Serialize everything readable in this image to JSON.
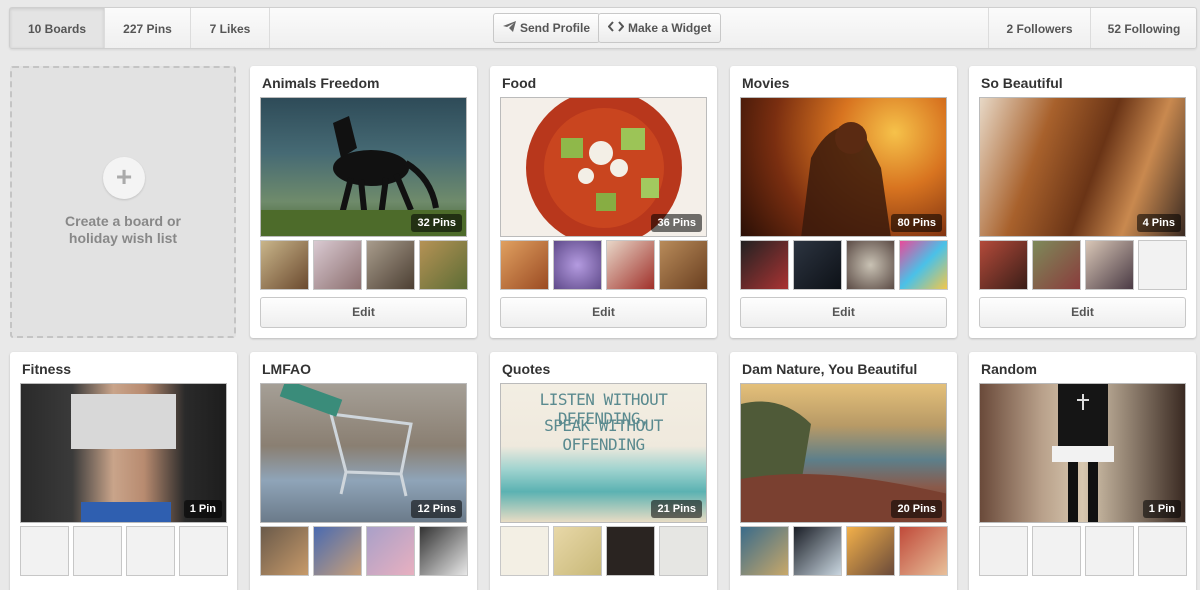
{
  "topbar": {
    "boards": "10 Boards",
    "pins": "227 Pins",
    "likes": "7 Likes",
    "send_profile": "Send Profile",
    "make_widget": "Make a Widget",
    "followers": "2 Followers",
    "following": "52 Following"
  },
  "create_board": {
    "line1": "Create a board or",
    "line2": "holiday wish list"
  },
  "boards": [
    {
      "title": "Animals Freedom",
      "count": "32 Pins",
      "edit": "Edit"
    },
    {
      "title": "Food",
      "count": "36 Pins",
      "edit": "Edit"
    },
    {
      "title": "Movies",
      "count": "80 Pins",
      "edit": "Edit"
    },
    {
      "title": "So Beautiful",
      "count": "4 Pins",
      "edit": "Edit"
    },
    {
      "title": "Fitness",
      "count": "1 Pin"
    },
    {
      "title": "LMFAO",
      "count": "12 Pins"
    },
    {
      "title": "Quotes",
      "count": "21 Pins",
      "quote1": "LISTEN WITHOUT DEFENDING,",
      "quote2": "SPEAK WITHOUT OFFENDING"
    },
    {
      "title": "Dam Nature, You Beautiful",
      "count": "20 Pins"
    },
    {
      "title": "Random",
      "count": "1 Pin"
    }
  ],
  "icons": {
    "send": "paper-plane-icon",
    "widget": "code-brackets-icon",
    "create": "plus-icon"
  }
}
